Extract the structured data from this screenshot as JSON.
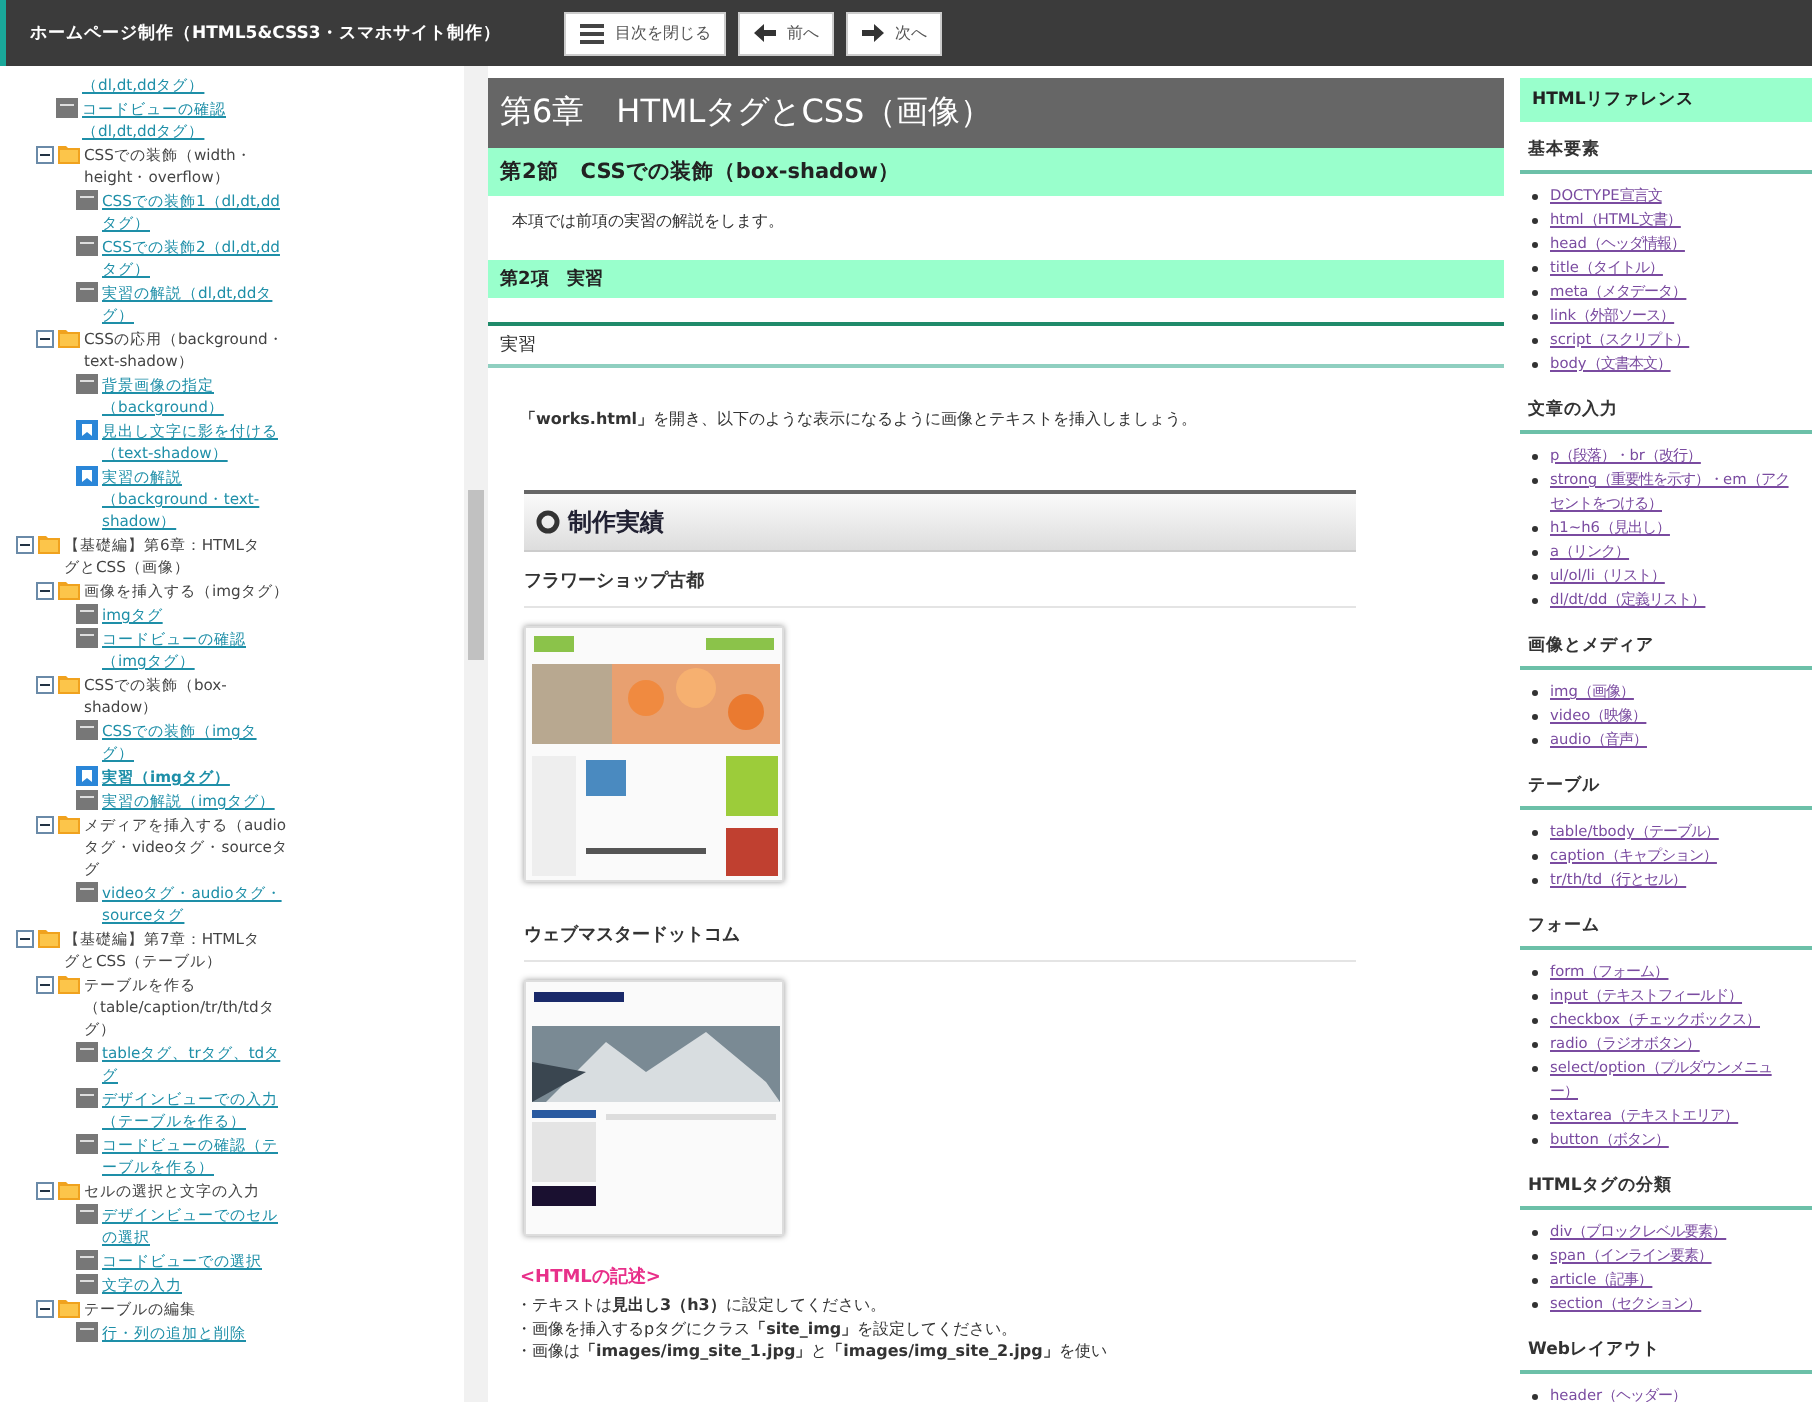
{
  "header": {
    "title": "ホームページ制作（HTML5&CSS3・スマホサイト制作）",
    "buttons": [
      {
        "kind": "toc",
        "label": "目次を閉じる"
      },
      {
        "kind": "prev",
        "label": "前へ"
      },
      {
        "kind": "next",
        "label": "次へ"
      }
    ]
  },
  "tree": [
    {
      "kind": "fragment",
      "label": "（dl,dt,ddタグ）",
      "selected": false
    },
    {
      "kind": "page",
      "label": "コードビューの確認（dl,dt,ddタグ）",
      "selected": false
    },
    {
      "kind": "folder",
      "label": "CSSでの装飾（width・height・overflow）",
      "expanded": true,
      "children": [
        {
          "kind": "page",
          "label": "CSSでの装飾1（dl,dt,ddタグ）",
          "selected": false
        },
        {
          "kind": "page",
          "label": "CSSでの装飾2（dl,dt,ddタグ）",
          "selected": false
        },
        {
          "kind": "page",
          "label": "実習の解説（dl,dt,ddタグ）",
          "selected": false
        }
      ]
    },
    {
      "kind": "folder",
      "label": "CSSの応用（background・text-shadow）",
      "expanded": true,
      "children": [
        {
          "kind": "page",
          "label": "背景画像の指定（background）",
          "selected": false
        },
        {
          "kind": "exercise",
          "label": "見出し文字に影を付ける（text-shadow）",
          "selected": false
        },
        {
          "kind": "exercise",
          "label": "実習の解説（background・text-shadow）",
          "selected": false
        }
      ]
    },
    {
      "kind": "chapter",
      "label": "【基礎編】第6章：HTMLタグとCSS（画像）",
      "expanded": true,
      "children": [
        {
          "kind": "folder",
          "label": "画像を挿入する（imgタグ）",
          "expanded": true,
          "children": [
            {
              "kind": "page",
              "label": "imgタグ",
              "selected": false
            },
            {
              "kind": "page",
              "label": "コードビューの確認（imgタグ）",
              "selected": false
            }
          ]
        },
        {
          "kind": "folder",
          "label": "CSSでの装飾（box-shadow）",
          "expanded": true,
          "children": [
            {
              "kind": "page",
              "label": "CSSでの装飾（imgタグ）",
              "selected": false
            },
            {
              "kind": "exercise",
              "label": "実習（imgタグ）",
              "selected": true
            },
            {
              "kind": "page",
              "label": "実習の解説（imgタグ）",
              "selected": false
            }
          ]
        },
        {
          "kind": "folder",
          "label": "メディアを挿入する（audioタグ・videoタグ・sourceタグ",
          "expanded": true,
          "children": [
            {
              "kind": "page",
              "label": "videoタグ・audioタグ・sourceタグ",
              "selected": false
            }
          ]
        }
      ]
    },
    {
      "kind": "chapter",
      "label": "【基礎編】第7章：HTMLタグとCSS（テーブル）",
      "expanded": true,
      "children": [
        {
          "kind": "folder",
          "label": "テーブルを作る（table/caption/tr/th/tdタグ）",
          "expanded": true,
          "children": [
            {
              "kind": "page",
              "label": "tableタグ、trタグ、tdタグ",
              "selected": false
            },
            {
              "kind": "page",
              "label": "デザインビューでの入力（テーブルを作る）",
              "selected": false
            },
            {
              "kind": "page",
              "label": "コードビューの確認（テーブルを作る）",
              "selected": false
            }
          ]
        },
        {
          "kind": "folder",
          "label": "セルの選択と文字の入力",
          "expanded": true,
          "children": [
            {
              "kind": "page",
              "label": "デザインビューでのセルの選択",
              "selected": false
            },
            {
              "kind": "page",
              "label": "コードビューでの選択",
              "selected": false
            },
            {
              "kind": "page",
              "label": "文字の入力",
              "selected": false
            }
          ]
        },
        {
          "kind": "folder",
          "label": "テーブルの編集",
          "expanded": true,
          "children": [
            {
              "kind": "page",
              "label": "行・列の追加と削除",
              "selected": false
            }
          ]
        }
      ]
    }
  ],
  "main": {
    "chapter": "第6章　HTMLタグとCSS（画像）",
    "section": "第2節　CSSでの装飾（box-shadow）",
    "intro": "本項では前項の実習の解説をします。",
    "item": "第2項　実習",
    "exercise_label": "実習",
    "instruction": "**「works.html」**を開き、以下のような表示になるように画像とテキストを挿入しましょう。",
    "sample": {
      "heading": "制作実績",
      "works": [
        {
          "title": "フラワーショップ古都",
          "kind": "picture"
        },
        {
          "title": "ウェブマスタードットコム",
          "kind": "picture"
        }
      ]
    },
    "code_heading": "<HTMLの記述>",
    "notes": [
      "・テキストは**見出し3（h3）**に設定してください。",
      "・画像を挿入するpタグにクラス**「site_img」**を設定してください。",
      "・画像は**「images/img_site_1.jpg」**と**「images/img_site_2.jpg」**を使い"
    ]
  },
  "reference": {
    "title": "HTMLリファレンス",
    "groups": [
      {
        "heading": "基本要素",
        "links": [
          "DOCTYPE宣言文",
          "html（HTML文書）",
          "head（ヘッダ情報）",
          "title（タイトル）",
          "meta（メタデータ）",
          "link（外部ソース）",
          "script（スクリプト）",
          "body（文書本文）"
        ]
      },
      {
        "heading": "文章の入力",
        "links": [
          "p（段落）・br（改行）",
          "strong（重要性を示す）・em（アクセントをつける）",
          "h1~h6（見出し）",
          "a（リンク）",
          "ul/ol/li（リスト）",
          "dl/dt/dd（定義リスト）"
        ]
      },
      {
        "heading": "画像とメディア",
        "links": [
          "img（画像）",
          "video（映像）",
          "audio（音声）"
        ]
      },
      {
        "heading": "テーブル",
        "links": [
          "table/tbody（テーブル）",
          "caption（キャプション）",
          "tr/th/td（行とセル）"
        ]
      },
      {
        "heading": "フォーム",
        "links": [
          "form（フォーム）",
          "input（テキストフィールド）",
          "checkbox（チェックボックス）",
          "radio（ラジオボタン）",
          "select/option（プルダウンメニュー）",
          "textarea（テキストエリア）",
          "button（ボタン）"
        ]
      },
      {
        "heading": "HTMLタグの分類",
        "links": [
          "div（ブロックレベル要素）",
          "span（インライン要素）",
          "article（記事）",
          "section（セクション）"
        ]
      },
      {
        "heading": "Webレイアウト",
        "links": [
          "header（ヘッダー）"
        ]
      }
    ]
  }
}
